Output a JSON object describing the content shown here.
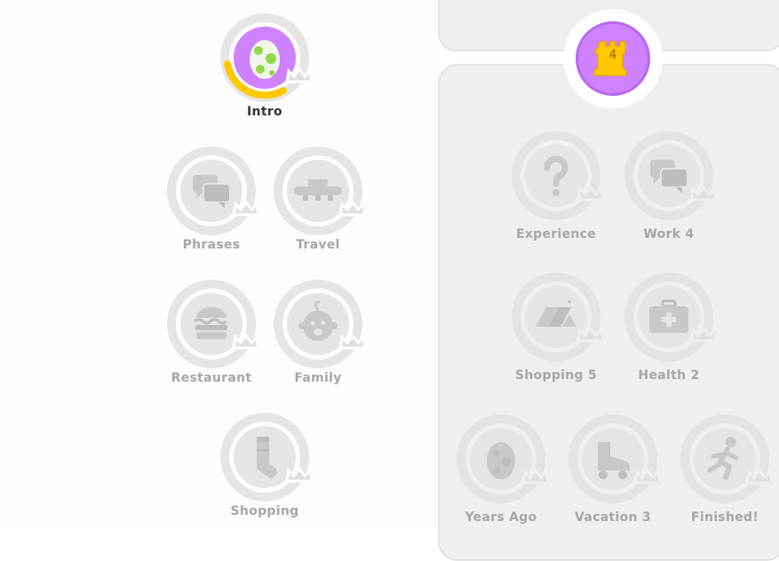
{
  "colors": {
    "locked_ring": "#e3e3e3",
    "locked_fill": "#e5e5e5",
    "locked_icon": "#c8c8c8",
    "active_fill": "#ce82ff",
    "progress": "#ffc800",
    "castle": "#ffc800",
    "text_active": "#333333",
    "text_locked": "#a6a6a6"
  },
  "left_column": {
    "skills": [
      {
        "label": "Intro",
        "icon": "egg-icon",
        "state": "active",
        "progress": 0.35
      },
      {
        "label": "Phrases",
        "icon": "chat-bubbles-icon",
        "state": "locked",
        "progress": 0
      },
      {
        "label": "Travel",
        "icon": "airplane-icon",
        "state": "locked",
        "progress": 0
      },
      {
        "label": "Restaurant",
        "icon": "burger-icon",
        "state": "locked",
        "progress": 0
      },
      {
        "label": "Family",
        "icon": "baby-icon",
        "state": "locked",
        "progress": 0
      },
      {
        "label": "Shopping",
        "icon": "sock-icon",
        "state": "locked",
        "progress": 0
      }
    ]
  },
  "checkpoint": {
    "number": "4",
    "icon": "castle-icon"
  },
  "right_column": {
    "skills": [
      {
        "label": "Experience",
        "icon": "question-mark-icon",
        "state": "locked"
      },
      {
        "label": "Work 4",
        "icon": "chat-bubbles-icon",
        "state": "locked"
      },
      {
        "label": "Shopping 5",
        "icon": "price-tags-icon",
        "state": "locked"
      },
      {
        "label": "Health 2",
        "icon": "first-aid-kit-icon",
        "state": "locked"
      },
      {
        "label": "Years Ago",
        "icon": "egg-icon",
        "state": "locked"
      },
      {
        "label": "Vacation 3",
        "icon": "roller-skate-icon",
        "state": "locked"
      },
      {
        "label": "Finished!",
        "icon": "running-person-icon",
        "state": "locked"
      }
    ]
  }
}
